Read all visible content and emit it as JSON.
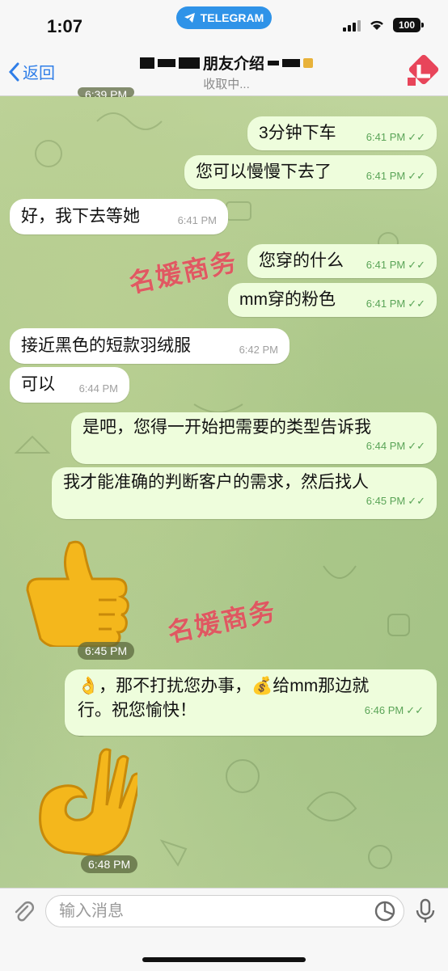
{
  "status_bar": {
    "time": "1:07",
    "pill_label": "TELEGRAM",
    "battery": "100"
  },
  "header": {
    "back_label": "返回",
    "title": "朋友介绍",
    "subtitle": "收取中..."
  },
  "messages": [
    {
      "dir": "out",
      "text": "3分钟下车",
      "time": "6:41 PM"
    },
    {
      "dir": "out",
      "text": "您可以慢慢下去了",
      "time": "6:41 PM"
    },
    {
      "dir": "in",
      "text": "好，我下去等她",
      "time": "6:41 PM"
    },
    {
      "dir": "out",
      "text": "您穿的什么",
      "time": "6:41 PM"
    },
    {
      "dir": "out",
      "text": "mm穿的粉色",
      "time": "6:41 PM"
    },
    {
      "dir": "in",
      "text": "接近黑色的短款羽绒服",
      "time": "6:42 PM"
    },
    {
      "dir": "in",
      "text": "可以",
      "time": "6:44 PM"
    },
    {
      "dir": "out",
      "text": "是吧，您得一开始把需要的类型告诉我",
      "time": "6:44 PM"
    },
    {
      "dir": "out",
      "text": "我才能准确的判断客户的需求，然后找人",
      "time": "6:45 PM"
    },
    {
      "dir": "in",
      "text": "👍",
      "time": "6:45 PM",
      "sticker": "thumbs-up"
    },
    {
      "dir": "out",
      "text_line1": "👌，那不打扰您办事，💰给mm那边就",
      "text_line2": "行。祝您愉快！",
      "time": "6:46 PM"
    },
    {
      "dir": "in",
      "text": "👌",
      "time": "6:48 PM",
      "sticker": "ok-hand"
    }
  ],
  "top_clipped_time": "6:39 PM",
  "watermark": "名媛商务",
  "input": {
    "placeholder": "输入消息"
  },
  "colors": {
    "accent": "#2f7ee8",
    "outgoing_bubble": "#eefddc",
    "incoming_bubble": "#ffffff",
    "watermark": "#e8455a",
    "telegram_pill": "#2f93e8"
  }
}
